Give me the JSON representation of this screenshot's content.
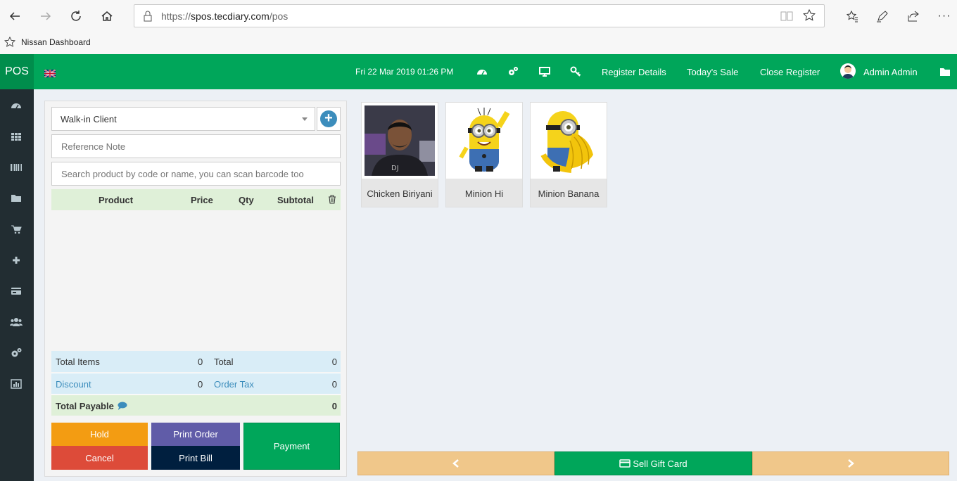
{
  "browser": {
    "url_scheme": "https://",
    "url_host": "spos.tecdiary.com",
    "url_path": "/pos",
    "favorites": [
      "Nissan Dashboard"
    ]
  },
  "header": {
    "logo": "POS",
    "datetime": "Fri 22 Mar 2019 01:26 PM",
    "links": [
      "Register Details",
      "Today's Sale",
      "Close Register"
    ],
    "user": "Admin Admin"
  },
  "sidebar": {
    "icons": [
      "dashboard-icon",
      "grid-icon",
      "barcode-icon",
      "folder-icon",
      "cart-icon",
      "plus-icon",
      "credit-card-icon",
      "users-icon",
      "settings-icon",
      "chart-icon"
    ]
  },
  "order": {
    "customer": "Walk-in Client",
    "reference_placeholder": "Reference Note",
    "search_placeholder": "Search product by code or name, you can scan barcode too",
    "columns": [
      "Product",
      "Price",
      "Qty",
      "Subtotal"
    ],
    "total_items_label": "Total Items",
    "total_items": "0",
    "total_label": "Total",
    "total": "0",
    "discount_label": "Discount",
    "discount": "0",
    "order_tax_label": "Order Tax",
    "order_tax": "0",
    "total_payable_label": "Total Payable",
    "total_payable": "0"
  },
  "actions": {
    "hold": "Hold",
    "print_order": "Print Order",
    "payment": "Payment",
    "cancel": "Cancel",
    "print_bill": "Print Bill"
  },
  "products": [
    {
      "name": "Chicken Biriyani"
    },
    {
      "name": "Minion Hi"
    },
    {
      "name": "Minion Banana"
    }
  ],
  "footer": {
    "sell_gift_card": "Sell Gift Card"
  },
  "colors": {
    "primary": "#00a65a",
    "sidebar": "#222d32",
    "hold": "#f39c12",
    "cancel": "#dd4b39",
    "print_order": "#605ca8",
    "print_bill": "#001f3f",
    "pager": "#f0c78a"
  }
}
